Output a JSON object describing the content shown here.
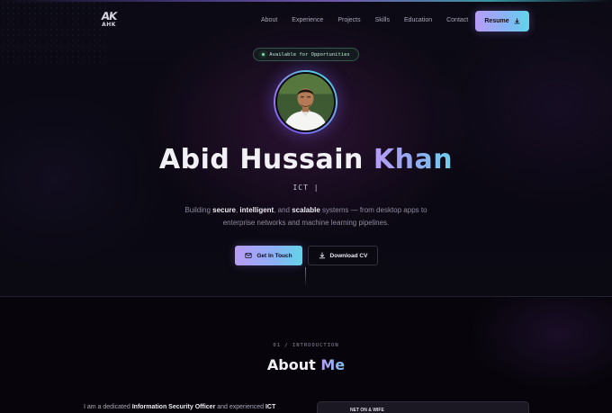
{
  "nav": {
    "logo": {
      "mark": "AK",
      "sub": "AHK"
    },
    "links": [
      "About",
      "Experience",
      "Projects",
      "Skills",
      "Education",
      "Contact"
    ],
    "resume_label": "Resume"
  },
  "hero": {
    "badge": "Available for Opportunities",
    "name_first": "Abid Hussain",
    "name_last": "Khan",
    "role": "ICT |",
    "tagline_pre": "Building",
    "tagline_b1": "secure",
    "tagline_sep1": ",",
    "tagline_b2": "intelligent",
    "tagline_sep2": ", and",
    "tagline_b3": "scalable",
    "tagline_rest": "systems — from desktop apps to enterprise networks and machine learning pipelines.",
    "primary_cta": "Get In Touch",
    "secondary_cta": "Download CV"
  },
  "about": {
    "kicker": "01 / INTRODUCTION",
    "title_main": "About",
    "title_accent": "Me",
    "text_pre": "I am a dedicated",
    "text_b1": "Information Security Officer",
    "text_mid": "and experienced",
    "text_b2": "ICT",
    "card_text": "NET ON & WIFE"
  },
  "colors": {
    "accent_purple": "#b79cf6",
    "accent_cyan": "#5fd5ea",
    "background": "#08060d",
    "status_green": "#6ee7a0"
  }
}
